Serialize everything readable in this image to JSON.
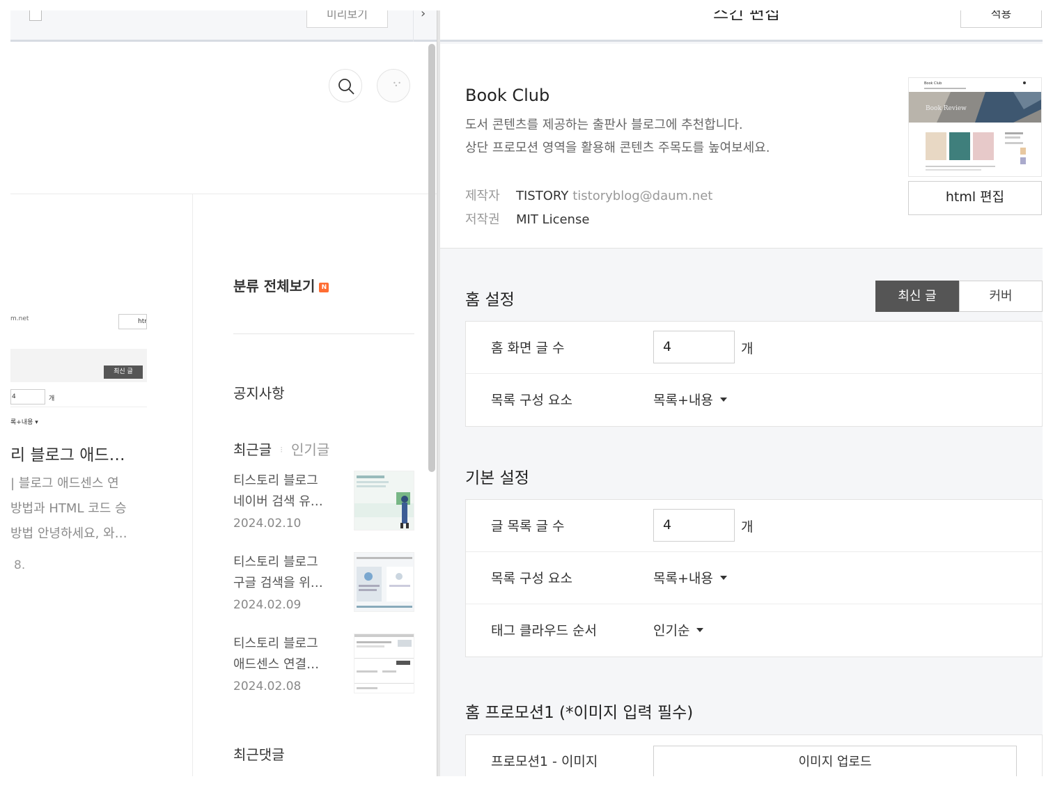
{
  "left": {
    "preview_button": "미리보기",
    "mini": {
      "email_fragment": "m.net",
      "html_fragment": "htm",
      "latest_label": "최신 글",
      "count_value": "4",
      "count_unit": "개",
      "dropdown": "록+내용 ▾"
    },
    "post": {
      "title": "리 블로그 애드…",
      "excerpt": [
        "| 블로그 애드센스 연",
        "방법과 HTML 코드 승",
        "방법 안녕하세요, 와…"
      ],
      "date": "8."
    },
    "sidebar": {
      "category_title": "분류 전체보기",
      "new_badge": "N",
      "notice": "공지사항",
      "tab_recent": "최근글",
      "tab_popular": "인기글",
      "recent_posts": [
        {
          "title1": "티스토리 블로그",
          "title2": "네이버 검색 유…",
          "date": "2024.02.10"
        },
        {
          "title1": "티스토리 블로그",
          "title2": "구글 검색을 위…",
          "date": "2024.02.09"
        },
        {
          "title1": "티스토리 블로그",
          "title2": "애드센스 연결…",
          "date": "2024.02.08"
        }
      ],
      "recent_comments": "최근댓글"
    }
  },
  "right": {
    "title": "스킨 편집",
    "apply_button": "적용",
    "skin": {
      "name": "Book Club",
      "desc1": "도서 콘텐츠를 제공하는 출판사 블로그에 추천합니다.",
      "desc2": "상단 프로모션 영역을 활용해 콘텐츠 주목도를 높여보세요.",
      "author_label": "제작자",
      "author": "TISTORY",
      "author_email": "tistoryblog@daum.net",
      "license_label": "저작권",
      "license": "MIT License",
      "thumb_title": "Book Club",
      "thumb_hero": "Book Review",
      "html_edit_button": "html 편집"
    },
    "home": {
      "title": "홈 설정",
      "toggle_latest": "최신 글",
      "toggle_cover": "커버",
      "post_count_label": "홈 화면 글 수",
      "post_count_value": "4",
      "unit": "개",
      "list_element_label": "목록 구성 요소",
      "list_element_value": "목록+내용"
    },
    "basic": {
      "title": "기본 설정",
      "list_count_label": "글 목록 글 수",
      "list_count_value": "4",
      "unit": "개",
      "list_element_label": "목록 구성 요소",
      "list_element_value": "목록+내용",
      "tag_order_label": "태그 클라우드 순서",
      "tag_order_value": "인기순"
    },
    "promo": {
      "title": "홈 프로모션1 (*이미지 입력 필수)",
      "image_label": "프로모션1 - 이미지",
      "upload_button": "이미지 업로드"
    }
  },
  "colors": {
    "accent_badge": "#ff6d33",
    "toggle_active": "#555555",
    "panel_bg": "#f5f6f8"
  }
}
